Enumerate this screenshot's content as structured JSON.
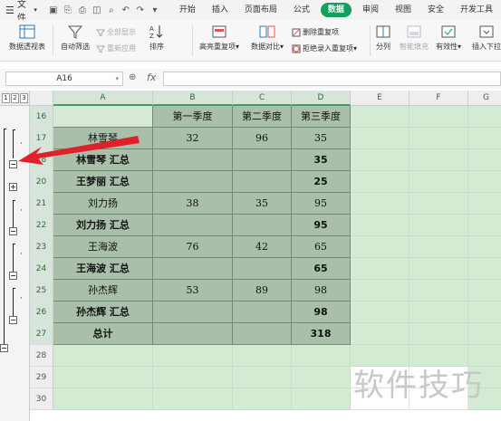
{
  "menubar": {
    "file_label": "文件",
    "tabs": [
      "开始",
      "插入",
      "页面布局",
      "公式",
      "数据",
      "审阅",
      "视图",
      "安全",
      "开发工具"
    ],
    "active_tab": "数据"
  },
  "ribbon": {
    "pivot_label": "数据透视表",
    "autofilter_label": "自动筛选",
    "show_all_label": "全部显示",
    "reapply_label": "重新应用",
    "sort_label": "排序",
    "highlight_dup_label": "高亮重复项",
    "compare_label": "数据对比",
    "remove_dup_label": "删除重复项",
    "reject_dup_label": "拒绝录入重复项",
    "split_label": "分列",
    "smart_fill_label": "智能填充",
    "validity_label": "有效性",
    "insert_dropdown_label": "插入下拉"
  },
  "formula_bar": {
    "name_box": "A16",
    "fx": "fx",
    "value": ""
  },
  "sheet": {
    "outline_levels": [
      "1",
      "2",
      "3"
    ],
    "columns": [
      "A",
      "B",
      "C",
      "D",
      "E",
      "F",
      "G"
    ],
    "rows": [
      {
        "num": "16",
        "cells": [
          "",
          "第一季度",
          "第二季度",
          "第三季度"
        ],
        "bold": false
      },
      {
        "num": "17",
        "cells": [
          "林雪琴",
          "32",
          "96",
          "35"
        ],
        "bold": false
      },
      {
        "num": "18",
        "cells": [
          "林雪琴 汇总",
          "",
          "",
          "35"
        ],
        "bold": true
      },
      {
        "num": "20",
        "cells": [
          "王梦丽 汇总",
          "",
          "",
          "25"
        ],
        "bold": true
      },
      {
        "num": "21",
        "cells": [
          "刘力扬",
          "38",
          "35",
          "95"
        ],
        "bold": false
      },
      {
        "num": "22",
        "cells": [
          "刘力扬 汇总",
          "",
          "",
          "95"
        ],
        "bold": true
      },
      {
        "num": "23",
        "cells": [
          "王海波",
          "76",
          "42",
          "65"
        ],
        "bold": false
      },
      {
        "num": "24",
        "cells": [
          "王海波 汇总",
          "",
          "",
          "65"
        ],
        "bold": true
      },
      {
        "num": "25",
        "cells": [
          "孙杰辉",
          "53",
          "89",
          "98"
        ],
        "bold": false
      },
      {
        "num": "26",
        "cells": [
          "孙杰辉 汇总",
          "",
          "",
          "98"
        ],
        "bold": true
      },
      {
        "num": "27",
        "cells": [
          "总计",
          "",
          "",
          "318"
        ],
        "bold": true
      },
      {
        "num": "28",
        "cells": [
          "",
          "",
          "",
          ""
        ],
        "bold": false
      },
      {
        "num": "29",
        "cells": [
          "",
          "",
          "",
          ""
        ],
        "bold": false
      },
      {
        "num": "30",
        "cells": [
          "",
          "",
          "",
          ""
        ],
        "bold": false
      }
    ]
  },
  "watermark": "软件技巧",
  "colors": {
    "accent": "#12a05c",
    "selection_fill": "#a9bfa9",
    "annotation_arrow": "#e0202a"
  }
}
